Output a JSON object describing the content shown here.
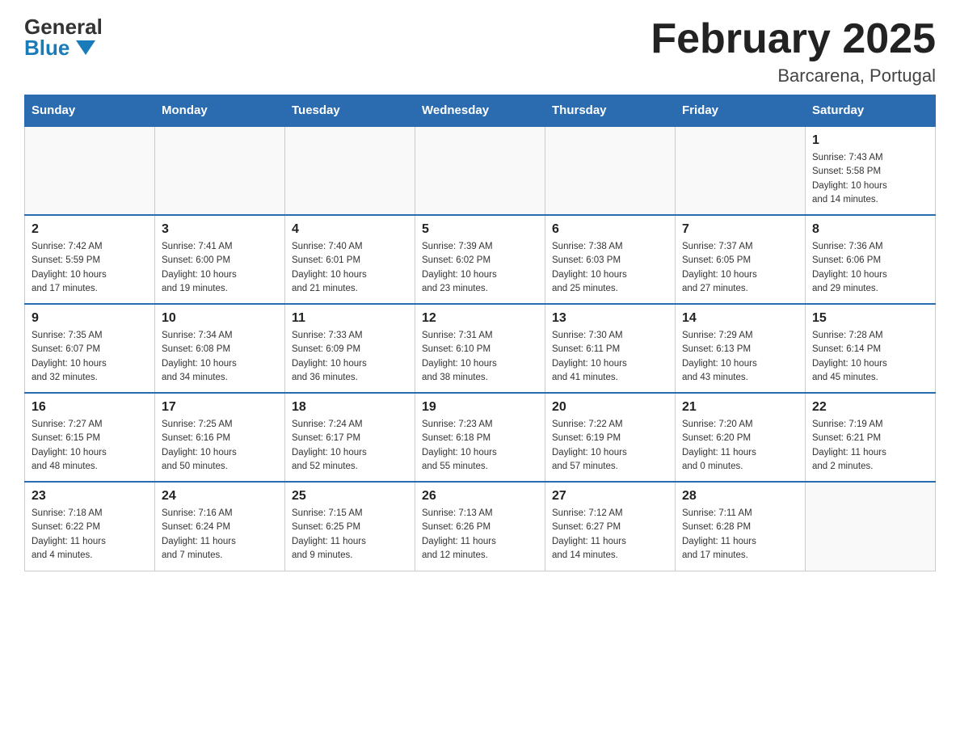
{
  "logo": {
    "general": "General",
    "blue": "Blue"
  },
  "header": {
    "month": "February 2025",
    "location": "Barcarena, Portugal"
  },
  "days_of_week": [
    "Sunday",
    "Monday",
    "Tuesday",
    "Wednesday",
    "Thursday",
    "Friday",
    "Saturday"
  ],
  "weeks": [
    [
      {
        "day": "",
        "info": ""
      },
      {
        "day": "",
        "info": ""
      },
      {
        "day": "",
        "info": ""
      },
      {
        "day": "",
        "info": ""
      },
      {
        "day": "",
        "info": ""
      },
      {
        "day": "",
        "info": ""
      },
      {
        "day": "1",
        "info": "Sunrise: 7:43 AM\nSunset: 5:58 PM\nDaylight: 10 hours\nand 14 minutes."
      }
    ],
    [
      {
        "day": "2",
        "info": "Sunrise: 7:42 AM\nSunset: 5:59 PM\nDaylight: 10 hours\nand 17 minutes."
      },
      {
        "day": "3",
        "info": "Sunrise: 7:41 AM\nSunset: 6:00 PM\nDaylight: 10 hours\nand 19 minutes."
      },
      {
        "day": "4",
        "info": "Sunrise: 7:40 AM\nSunset: 6:01 PM\nDaylight: 10 hours\nand 21 minutes."
      },
      {
        "day": "5",
        "info": "Sunrise: 7:39 AM\nSunset: 6:02 PM\nDaylight: 10 hours\nand 23 minutes."
      },
      {
        "day": "6",
        "info": "Sunrise: 7:38 AM\nSunset: 6:03 PM\nDaylight: 10 hours\nand 25 minutes."
      },
      {
        "day": "7",
        "info": "Sunrise: 7:37 AM\nSunset: 6:05 PM\nDaylight: 10 hours\nand 27 minutes."
      },
      {
        "day": "8",
        "info": "Sunrise: 7:36 AM\nSunset: 6:06 PM\nDaylight: 10 hours\nand 29 minutes."
      }
    ],
    [
      {
        "day": "9",
        "info": "Sunrise: 7:35 AM\nSunset: 6:07 PM\nDaylight: 10 hours\nand 32 minutes."
      },
      {
        "day": "10",
        "info": "Sunrise: 7:34 AM\nSunset: 6:08 PM\nDaylight: 10 hours\nand 34 minutes."
      },
      {
        "day": "11",
        "info": "Sunrise: 7:33 AM\nSunset: 6:09 PM\nDaylight: 10 hours\nand 36 minutes."
      },
      {
        "day": "12",
        "info": "Sunrise: 7:31 AM\nSunset: 6:10 PM\nDaylight: 10 hours\nand 38 minutes."
      },
      {
        "day": "13",
        "info": "Sunrise: 7:30 AM\nSunset: 6:11 PM\nDaylight: 10 hours\nand 41 minutes."
      },
      {
        "day": "14",
        "info": "Sunrise: 7:29 AM\nSunset: 6:13 PM\nDaylight: 10 hours\nand 43 minutes."
      },
      {
        "day": "15",
        "info": "Sunrise: 7:28 AM\nSunset: 6:14 PM\nDaylight: 10 hours\nand 45 minutes."
      }
    ],
    [
      {
        "day": "16",
        "info": "Sunrise: 7:27 AM\nSunset: 6:15 PM\nDaylight: 10 hours\nand 48 minutes."
      },
      {
        "day": "17",
        "info": "Sunrise: 7:25 AM\nSunset: 6:16 PM\nDaylight: 10 hours\nand 50 minutes."
      },
      {
        "day": "18",
        "info": "Sunrise: 7:24 AM\nSunset: 6:17 PM\nDaylight: 10 hours\nand 52 minutes."
      },
      {
        "day": "19",
        "info": "Sunrise: 7:23 AM\nSunset: 6:18 PM\nDaylight: 10 hours\nand 55 minutes."
      },
      {
        "day": "20",
        "info": "Sunrise: 7:22 AM\nSunset: 6:19 PM\nDaylight: 10 hours\nand 57 minutes."
      },
      {
        "day": "21",
        "info": "Sunrise: 7:20 AM\nSunset: 6:20 PM\nDaylight: 11 hours\nand 0 minutes."
      },
      {
        "day": "22",
        "info": "Sunrise: 7:19 AM\nSunset: 6:21 PM\nDaylight: 11 hours\nand 2 minutes."
      }
    ],
    [
      {
        "day": "23",
        "info": "Sunrise: 7:18 AM\nSunset: 6:22 PM\nDaylight: 11 hours\nand 4 minutes."
      },
      {
        "day": "24",
        "info": "Sunrise: 7:16 AM\nSunset: 6:24 PM\nDaylight: 11 hours\nand 7 minutes."
      },
      {
        "day": "25",
        "info": "Sunrise: 7:15 AM\nSunset: 6:25 PM\nDaylight: 11 hours\nand 9 minutes."
      },
      {
        "day": "26",
        "info": "Sunrise: 7:13 AM\nSunset: 6:26 PM\nDaylight: 11 hours\nand 12 minutes."
      },
      {
        "day": "27",
        "info": "Sunrise: 7:12 AM\nSunset: 6:27 PM\nDaylight: 11 hours\nand 14 minutes."
      },
      {
        "day": "28",
        "info": "Sunrise: 7:11 AM\nSunset: 6:28 PM\nDaylight: 11 hours\nand 17 minutes."
      },
      {
        "day": "",
        "info": ""
      }
    ]
  ]
}
